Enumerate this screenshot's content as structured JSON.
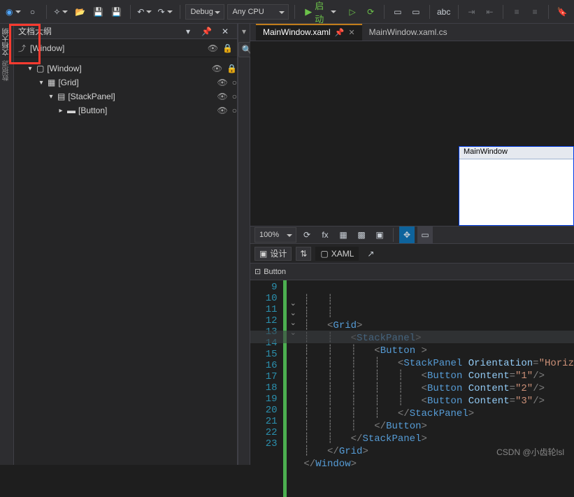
{
  "toolbar": {
    "config_label": "Debug",
    "platform_label": "Any CPU",
    "start_label": "启动"
  },
  "panel": {
    "title": "文档大纲",
    "root": "[Window]"
  },
  "tree": [
    {
      "label": "[Window]",
      "indent": 12,
      "expander": "▾",
      "eye": "👁",
      "lock": "🔒"
    },
    {
      "label": "[Grid]",
      "indent": 28,
      "expander": "▾",
      "eye": "👁",
      "dot": "○"
    },
    {
      "label": "[StackPanel]",
      "indent": 42,
      "expander": "▾",
      "eye": "👁",
      "dot": "○"
    },
    {
      "label": "[Button]",
      "indent": 56,
      "expander": "▸",
      "eye": "👁",
      "dot": "○"
    }
  ],
  "tabs": {
    "active": "MainWindow.xaml",
    "second": "MainWindow.xaml.cs"
  },
  "designer": {
    "window_title": "MainWindow",
    "zoom": "100%",
    "design_label": "设计",
    "xaml_label": "XAML",
    "breadcrumb": "Button"
  },
  "code": {
    "lines": [
      "9",
      "10",
      "11",
      "12",
      "13",
      "14",
      "15",
      "16",
      "17",
      "18",
      "19",
      "20",
      "21",
      "22",
      "23"
    ]
  },
  "watermark": "CSDN @小齿轮lsl"
}
